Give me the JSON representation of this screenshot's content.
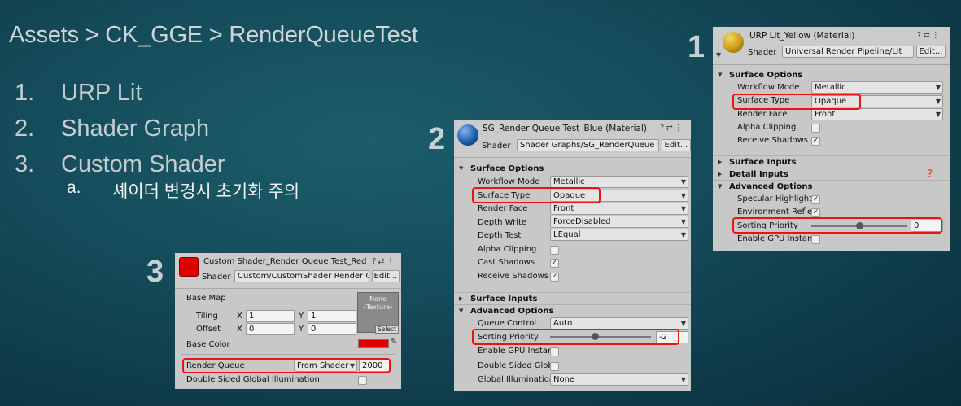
{
  "slide": {
    "title": "Assets > CK_GGE > RenderQueueTest",
    "list": [
      {
        "num": "1.",
        "text": "URP Lit"
      },
      {
        "num": "2.",
        "text": "Shader Graph"
      },
      {
        "num": "3.",
        "text": "Custom Shader"
      }
    ],
    "sub": {
      "num": "a.",
      "text": "셰이더 변경시 초기화 주의"
    },
    "labels": {
      "one": "1",
      "two": "2",
      "three": "3"
    }
  },
  "colors": {
    "yellow_sphere": "#c99a14",
    "blue_sphere": "#1e5ea8",
    "red_sphere": "#e00000",
    "highlight": "#ee1111"
  },
  "p1": {
    "name": "URP Lit_Yellow (Material)",
    "shader_label": "Shader",
    "shader": "Universal Render Pipeline/Lit",
    "edit": "Edit...",
    "surface_options": "Surface Options",
    "workflow_label": "Workflow Mode",
    "workflow": "Metallic",
    "surface_type_label": "Surface Type",
    "surface_type": "Opaque",
    "render_face_label": "Render Face",
    "render_face": "Front",
    "alpha_clip_label": "Alpha Clipping",
    "receive_label": "Receive Shadows",
    "surface_inputs": "Surface Inputs",
    "detail_inputs": "Detail Inputs",
    "advanced": "Advanced Options",
    "specular_label": "Specular Highlights",
    "env_label": "Environment Reflec",
    "sorting_label": "Sorting Priority",
    "sorting": "0",
    "sorting_level": 0.5,
    "gpu_label": "Enable GPU Instanc",
    "check": "✓"
  },
  "p2": {
    "name": "SG_Render Queue Test_Blue (Material)",
    "shader_label": "Shader",
    "shader": "Shader Graphs/SG_RenderQueueT",
    "edit": "Edit...",
    "surface_options": "Surface Options",
    "workflow_label": "Workflow Mode",
    "workflow": "Metallic",
    "surface_type_label": "Surface Type",
    "surface_type": "Opaque",
    "render_face_label": "Render Face",
    "render_face": "Front",
    "depth_write_label": "Depth Write",
    "depth_write": "ForceDisabled",
    "depth_test_label": "Depth Test",
    "depth_test": "LEqual",
    "alpha_clip_label": "Alpha Clipping",
    "cast_label": "Cast Shadows",
    "receive_label": "Receive Shadows",
    "surface_inputs": "Surface Inputs",
    "advanced": "Advanced Options",
    "queue_label": "Queue Control",
    "queue": "Auto",
    "sorting_label": "Sorting Priority",
    "sorting": "-2",
    "sorting_level": 0.45,
    "gpu_label": "Enable GPU Instan",
    "double_label": "Double Sided Glob",
    "gi_label": "Global Illumination",
    "gi": "None",
    "check": "✓"
  },
  "p3": {
    "name": "Custom Shader_Render Queue Test_Red",
    "shader_label": "Shader",
    "shader": "Custom/CustomShader Render Qu",
    "edit": "Edit...",
    "base_map": "Base Map",
    "tiling": "Tiling",
    "offset": "Offset",
    "x": "X",
    "y": "Y",
    "tiling_x": "1",
    "tiling_y": "1",
    "offset_x": "0",
    "offset_y": "0",
    "tex_line1": "None",
    "tex_line2": "(Texture)",
    "select": "Select",
    "base_color": "Base Color",
    "render_queue_label": "Render Queue",
    "render_queue_mode": "From Shader",
    "render_queue": "2000",
    "double_label": "Double Sided Global Illumination"
  }
}
